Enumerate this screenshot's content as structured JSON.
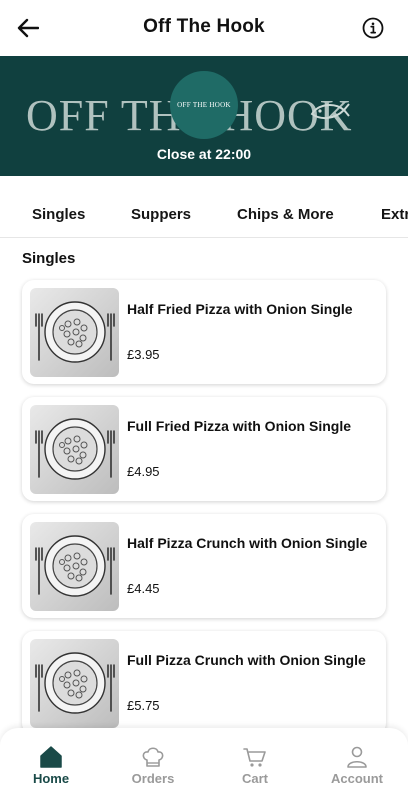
{
  "header": {
    "title": "Off The Hook",
    "back_icon": "arrow-left-icon",
    "info_icon": "info-icon"
  },
  "banner": {
    "big_text": "OFF THE HOOK",
    "logo_text": "OFF THE HOOK",
    "status": "Close at 22:00",
    "colors": {
      "background": "#10403f",
      "logo_circle": "#1f6b66"
    }
  },
  "tabs": [
    {
      "label": "Singles"
    },
    {
      "label": "Suppers"
    },
    {
      "label": "Chips & More"
    },
    {
      "label": "Extr"
    }
  ],
  "section": {
    "title": "Singles"
  },
  "items": [
    {
      "name": "Half Fried Pizza with Onion Single",
      "price": "£3.95"
    },
    {
      "name": "Full Fried Pizza with Onion Single",
      "price": "£4.95"
    },
    {
      "name": "Half Pizza Crunch with Onion Single",
      "price": "£4.45"
    },
    {
      "name": "Full Pizza Crunch with Onion Single",
      "price": "£5.75"
    }
  ],
  "bottom_nav": [
    {
      "label": "Home",
      "icon": "home-icon",
      "active": true
    },
    {
      "label": "Orders",
      "icon": "chef-hat-icon",
      "active": false
    },
    {
      "label": "Cart",
      "icon": "cart-icon",
      "active": false
    },
    {
      "label": "Account",
      "icon": "account-icon",
      "active": false
    }
  ]
}
